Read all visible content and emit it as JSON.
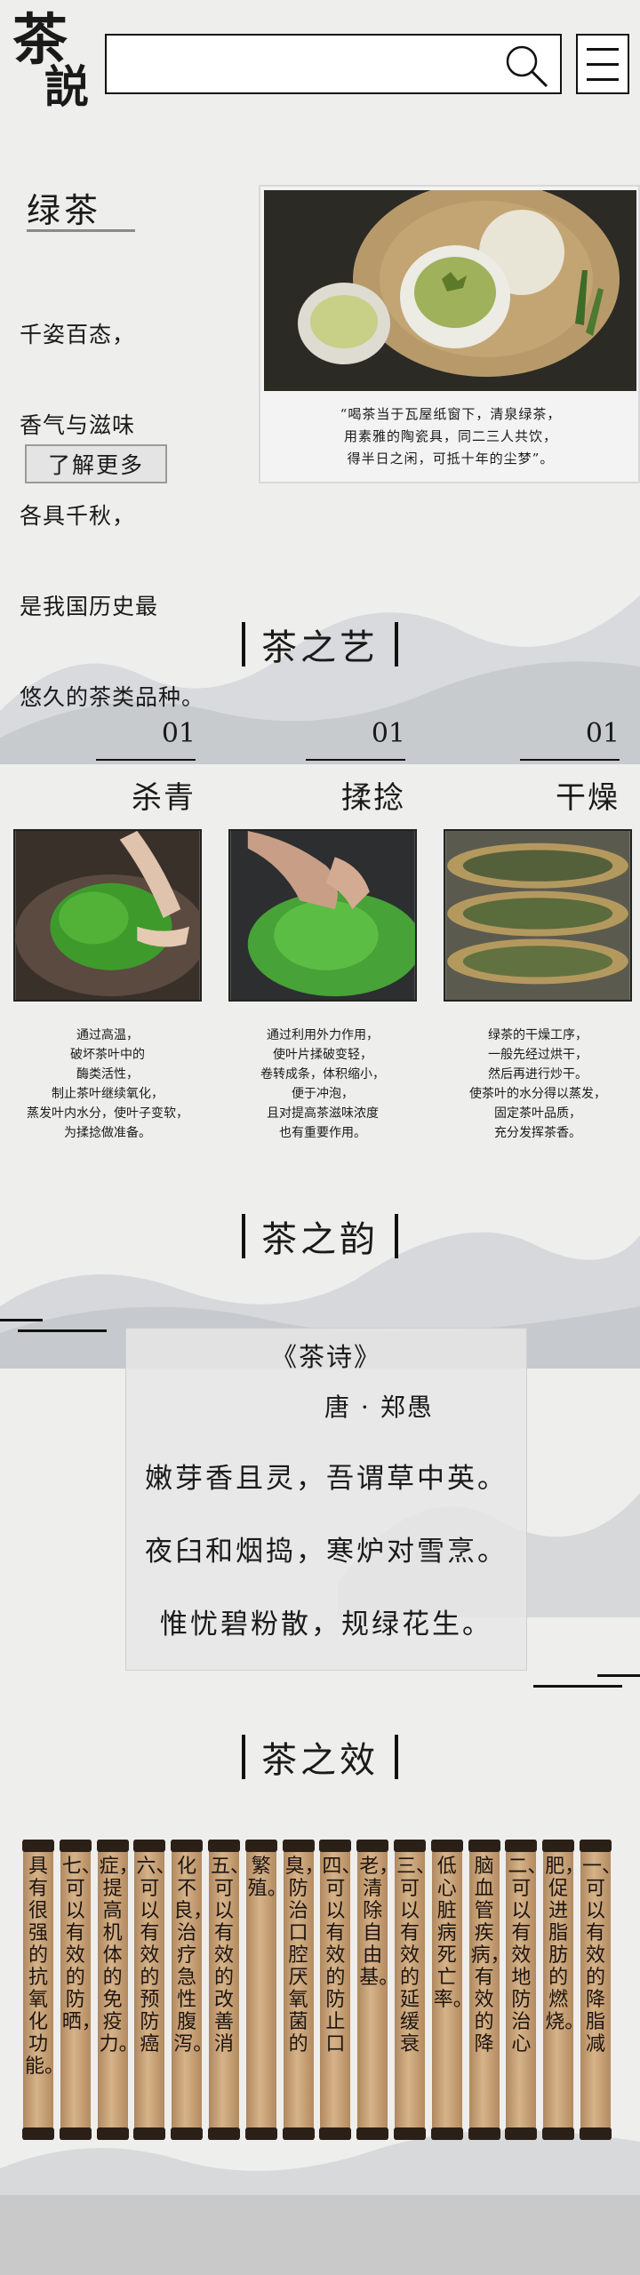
{
  "header": {
    "logo_char_1": "茶",
    "logo_char_2": "説",
    "search_placeholder": ""
  },
  "intro": {
    "title": "绿茶",
    "lines": [
      "千姿百态，",
      "香气与滋味",
      "各具千秋，",
      "是我国历史最",
      "悠久的茶类品种。"
    ],
    "learn_more": "了解更多",
    "quote": "“喝茶当于瓦屋纸窗下，清泉绿茶，\n用素雅的陶瓷具，同二三人共饮，\n得半日之闲，可抵十年的尘梦”。"
  },
  "art": {
    "title": "茶之艺",
    "steps": [
      {
        "num": "01",
        "name": "杀青",
        "desc": "通过高温，\n破坏茶叶中的\n酶类活性，\n制止茶叶继续氧化，\n蒸发叶内水分，使叶子变软，\n为揉捻做准备。"
      },
      {
        "num": "01",
        "name": "揉捻",
        "desc": "通过利用外力作用，\n使叶片揉破变轻，\n卷转成条，体积缩小，\n便于冲泡，\n且对提高茶滋味浓度\n也有重要作用。"
      },
      {
        "num": "01",
        "name": "干燥",
        "desc": "绿茶的干燥工序，\n一般先经过烘干，\n然后再进行炒干。\n使茶叶的水分得以蒸发，\n固定茶叶品质，\n充分发挥茶香。"
      }
    ]
  },
  "poem_section": {
    "title": "茶之韵",
    "poem_title": "《茶诗》",
    "author": "唐 · 郑愚",
    "lines": [
      "嫩芽香且灵，吾谓草中英。",
      "夜臼和烟捣，寒炉对雪烹。",
      "惟忧碧粉散，规绿花生。"
    ]
  },
  "effect": {
    "title": "茶之效",
    "scrolls": [
      "具有很强的抗氧化功能。",
      "七、可以有效的防晒，",
      "症，提高机体的免疫力。",
      "六、可以有效的预防癌",
      "化不良，治疗急性腹泻。",
      "五、可以有效的改善消",
      "繁殖。",
      "臭，防治口腔厌氧菌的",
      "四、可以有效的防止口",
      "老，清除自由基。",
      "三、可以有效的延缓衰",
      "低心脏病死亡率。",
      "脑血管疾病，有效的降",
      "二、可以有效地防治心",
      "肥，促进脂肪的燃烧。",
      "一、可以有效的降脂减"
    ]
  },
  "colors": {
    "background": "#eeeeed",
    "scroll": "#d6b389",
    "ink": "#111111"
  }
}
